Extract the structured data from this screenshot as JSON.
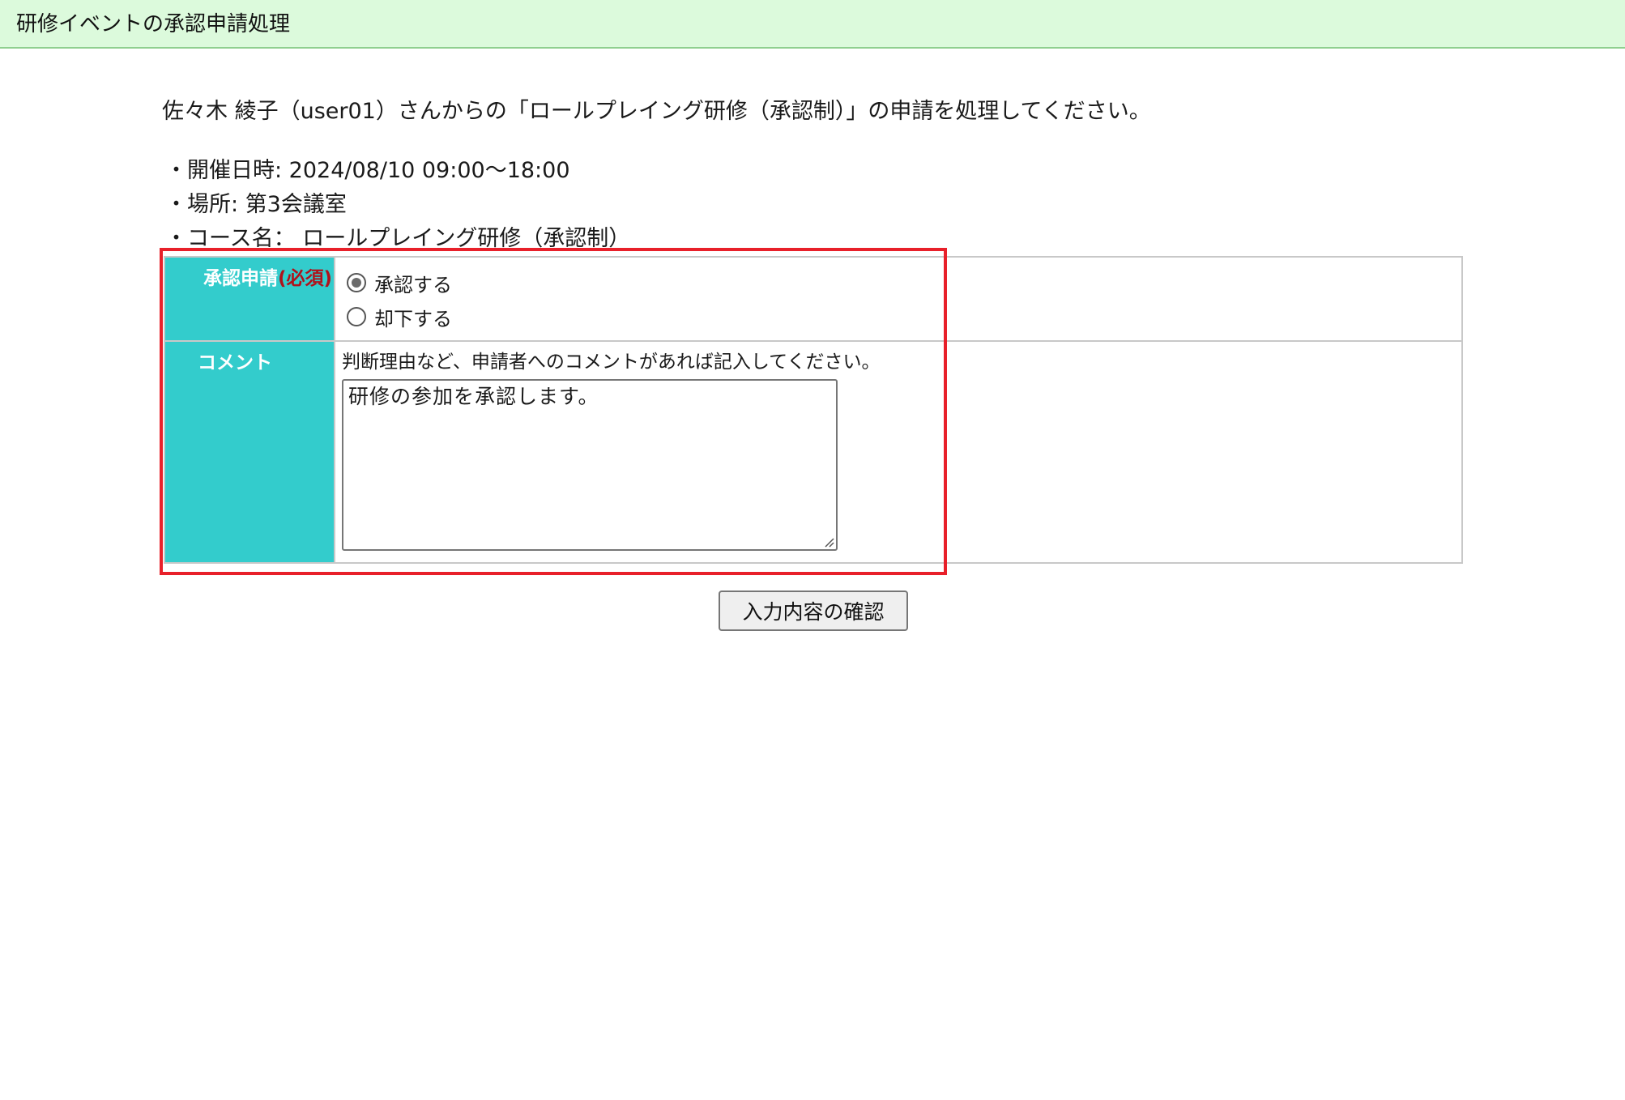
{
  "header": {
    "title": "研修イベントの承認申請処理"
  },
  "intro": {
    "text": "佐々木 綾子（user01）さんからの「ロールプレイング研修（承認制）」の申請を処理してください。"
  },
  "details": {
    "date": "・開催日時: 2024/08/10 09:00～18:00",
    "place": "・場所: 第3会議室",
    "course": "・コース名： ロールプレイング研修（承認制）"
  },
  "form": {
    "approval": {
      "label": "承認申請",
      "required": "(必須)",
      "options": [
        {
          "label": "承認する",
          "checked": true
        },
        {
          "label": "却下する",
          "checked": false
        }
      ]
    },
    "comment": {
      "label": "コメント",
      "hint": "判断理由など、申請者へのコメントがあれば記入してください。",
      "value": "研修の参加を承認します。"
    }
  },
  "actions": {
    "confirm_label": "入力内容の確認"
  },
  "colors": {
    "header_bg": "#dcfadc",
    "label_bg": "#33cccc",
    "required": "#b0121b",
    "highlight": "#e8202a"
  }
}
